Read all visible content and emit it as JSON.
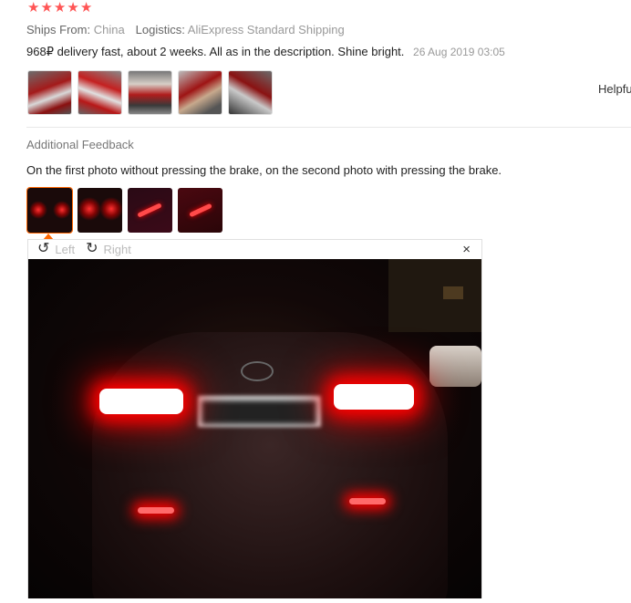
{
  "review": {
    "stars": [
      "★",
      "★",
      "★",
      "★",
      "★"
    ],
    "ships_from_label": "Ships From:",
    "ships_from_value": "China",
    "logistics_label": "Logistics:",
    "logistics_value": "AliExpress Standard Shipping",
    "comment": "968₽ delivery fast, about 2 weeks. All as in the description. Shine bright.",
    "date": "26 Aug 2019 03:05",
    "helpful": "Helpfu"
  },
  "additional": {
    "title": "Additional Feedback",
    "text": "On the first photo without pressing the brake, on the second photo with pressing the brake."
  },
  "viewer": {
    "left_label": "Left",
    "right_label": "Right",
    "close_symbol": "×"
  },
  "icons": {
    "star": "star-icon",
    "rotate_left": "rotate-left-icon",
    "rotate_right": "rotate-right-icon",
    "close": "close-icon"
  },
  "colors": {
    "star": "#ff5555",
    "selected_border": "#ff6600",
    "brake_light": "#ff0000"
  }
}
